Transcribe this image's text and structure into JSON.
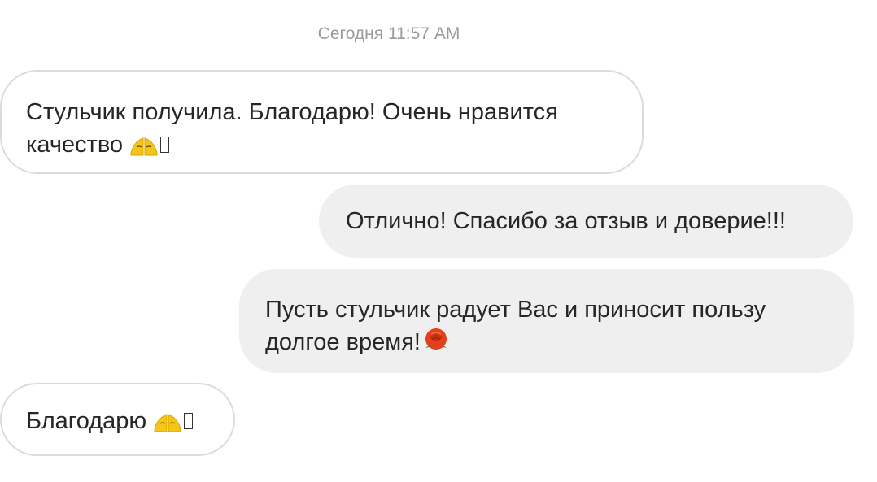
{
  "thread": {
    "timestamp": "Сегодня 11:57 AM",
    "messages": [
      {
        "direction": "incoming",
        "line1": "Стульчик получила. Благодарю! Очень нравится",
        "line2": "качество",
        "emoji": "folded-hands-icon"
      },
      {
        "direction": "outgoing",
        "line1": "Отлично! Спасибо за отзыв и доверие!!!"
      },
      {
        "direction": "outgoing",
        "line1": "Пусть стульчик радует Вас и приносит пользу",
        "line2": "долгое время!",
        "emoji": "rose-icon"
      },
      {
        "direction": "incoming",
        "line1": "Благодарю",
        "emoji": "folded-hands-icon"
      }
    ]
  },
  "colors": {
    "outgoing_bubble": "#efefef",
    "incoming_border": "#dbdbdb",
    "timestamp": "#9a9a9a",
    "text": "#262626"
  }
}
